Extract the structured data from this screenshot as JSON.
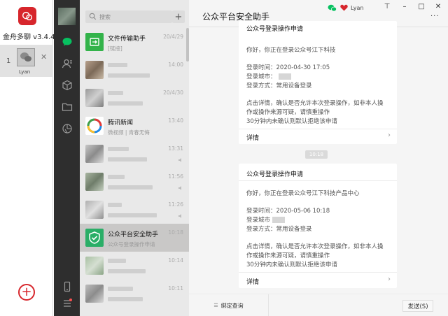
{
  "app": {
    "name": "金舟多聊 v3.4.4",
    "account_index": "1",
    "account_name": "Lyan",
    "close": "✕",
    "add": "+"
  },
  "search": {
    "placeholder": "搜索",
    "plus": "+"
  },
  "chats": [
    {
      "name": "文件传输助手",
      "preview": "[链接]",
      "time": "20/4/29"
    },
    {
      "name": "",
      "preview": "",
      "time": "14:00"
    },
    {
      "name": "",
      "preview": "",
      "time": "20/4/30"
    },
    {
      "name": "腾讯新闻",
      "preview": "微视频 | 青春无悔",
      "time": "13:40"
    },
    {
      "name": "",
      "preview": "",
      "time": "13:31"
    },
    {
      "name": "",
      "preview": "",
      "time": "11:56"
    },
    {
      "name": "",
      "preview": "",
      "time": "11:26"
    },
    {
      "name": "公众平台安全助手",
      "preview": "公众号登录操作申请",
      "time": "10:18"
    },
    {
      "name": "",
      "preview": "",
      "time": "10:14"
    },
    {
      "name": "",
      "preview": "",
      "time": "10:11"
    }
  ],
  "chat": {
    "title": "公众平台安全助手",
    "user": "Lyan",
    "more": "···",
    "time_chip": "10:18",
    "cards": [
      {
        "title": "公众号登录操作申请",
        "greeting": "你好，你正在登录公众号江下科技",
        "login_time": "登录时间：2020-04-30 17:05",
        "login_city": "登录城市：",
        "login_method": "登录方式：常用设备登录",
        "body1": "点击详情，确认是否允许本次登录操作，如非本人操",
        "body2": "作或操作来源可疑，请慎重操作",
        "body3": "30分钟内未确认则默认拒绝该申请",
        "detail": "详情"
      },
      {
        "title": "公众号登录操作申请",
        "greeting": "你好，你正在登录公众号江下科技产品中心",
        "login_time": "登录时间：2020-05-06 10:18",
        "login_city": "登录城市",
        "login_method": "登录方式：常用设备登录",
        "body1": "点击详情，确认是否允许本次登录操作，如非本人操",
        "body2": "作或操作来源可疑，请慎重操作",
        "body3": "30分钟内未确认则默认拒绝该申请",
        "detail": "详情"
      }
    ],
    "menu_label": "绑定查询",
    "send_label": "发送(S)"
  },
  "colors": {
    "brand_red": "#d7262c",
    "wechat_green": "#07c160",
    "sidebar_dark": "#2e2e2e"
  }
}
